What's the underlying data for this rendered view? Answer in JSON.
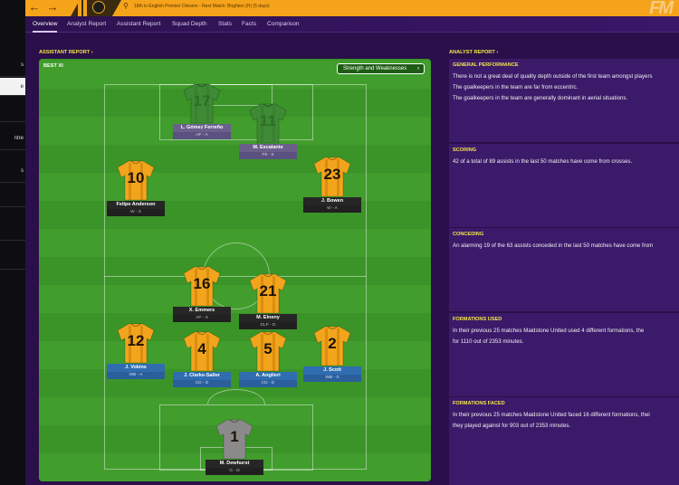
{
  "topbar": {
    "back_icon": "arrow-left-icon",
    "forward_icon": "arrow-right-icon",
    "subtitle": "18th in English Premier Division - Next Match: Brighton (H) (5 days)",
    "logo": "FM"
  },
  "sidebar": {
    "items": [
      {
        "label": "s",
        "active": false
      },
      {
        "label": "e",
        "active": true
      },
      {
        "label": "",
        "active": false
      },
      {
        "label": "ntre",
        "active": false
      },
      {
        "label": "s",
        "active": false
      },
      {
        "label": "",
        "active": false
      },
      {
        "label": "",
        "active": false
      }
    ]
  },
  "tabs": [
    "Overview",
    "Analyst Report",
    "Assistant Report",
    "Squad Depth",
    "Stats",
    "Facts",
    "Comparison"
  ],
  "assistant": {
    "header": "ASSISTANT REPORT",
    "best_xi": "BEST XI",
    "strength_btn": "Strength and Weaknesses"
  },
  "players": [
    {
      "number": "17",
      "name": "L. Gómez Ferreño",
      "pos": "AF - A",
      "style": "dim"
    },
    {
      "number": "11",
      "name": "M. Escalante",
      "pos": "F9 - S",
      "style": "dim"
    },
    {
      "number": "10",
      "name": "Felipe Anderson",
      "pos": "W - S",
      "style": "normal"
    },
    {
      "number": "23",
      "name": "J. Bowen",
      "pos": "W - A",
      "style": "normal"
    },
    {
      "number": "16",
      "name": "X. Emmers",
      "pos": "AP - S",
      "style": "normal"
    },
    {
      "number": "21",
      "name": "M. Elneny",
      "pos": "DLP - D",
      "style": "normal"
    },
    {
      "number": "12",
      "name": "J. Vokins",
      "pos": "WB - A",
      "style": "blue"
    },
    {
      "number": "4",
      "name": "J. Clarke-Salter",
      "pos": "CD - D",
      "style": "blue"
    },
    {
      "number": "5",
      "name": "A. Anglieri",
      "pos": "CD - D",
      "style": "blue"
    },
    {
      "number": "2",
      "name": "J. Scott",
      "pos": "WB - S",
      "style": "blue"
    },
    {
      "number": "1",
      "name": "M. Dewhurst",
      "pos": "G - D",
      "style": "gk"
    }
  ],
  "analyst": {
    "header": "ANALYST REPORT",
    "sections": [
      {
        "title": "GENERAL PERFORMANCE",
        "lines": [
          "There is not a great deal of quality depth outside of the first team amongst players",
          "The goalkeepers in the team are far from eccentric.",
          "The goalkeepers in the team are generally dominant in aerial situations."
        ]
      },
      {
        "title": "SCORING",
        "lines": [
          "42 of a total of 89 assists in the last 50 matches have come from crosses."
        ]
      },
      {
        "title": "CONCEDING",
        "lines": [
          "An alarming 19 of the 63 assists conceded in the last 50 matches have come from"
        ]
      },
      {
        "title": "FORMATIONS USED",
        "lines": [
          "In their previous 25 matches Maidstone United used 4 different formations, the",
          "for 1110 out of 2353 minutes."
        ]
      },
      {
        "title": "FORMATIONS FACED",
        "lines": [
          "In their previous 25 matches Maidstone United faced 16 different formations, thei",
          "they played against for 903 out of 2353 minutes."
        ]
      }
    ]
  },
  "colors": {
    "shirt": "#f2a51c",
    "shirt_stripe": "#c97a06",
    "gk": "#8a8a8a",
    "dim_shirt": "#3f8a35"
  }
}
